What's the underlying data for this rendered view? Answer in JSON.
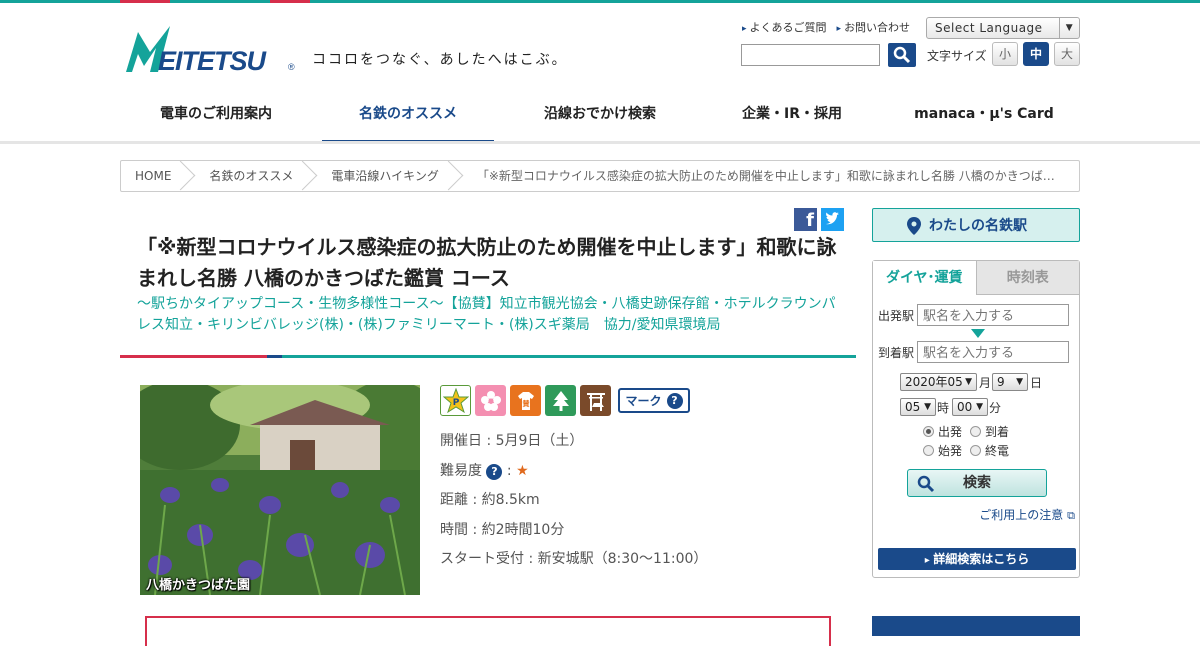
{
  "header": {
    "logo_text": "MEITETSU",
    "tagline": "ココロをつなぐ、あしたへはこぶ。",
    "util_links": [
      "よくあるご質問",
      "お問い合わせ"
    ],
    "language_select": "Select Language",
    "fontsize_label": "文字サイズ",
    "fontsize_options": [
      "小",
      "中",
      "大"
    ]
  },
  "nav": {
    "items": [
      "電車のご利用案内",
      "名鉄のオススメ",
      "沿線おでかけ検索",
      "企業・IR・採用",
      "manaca・μ's Card"
    ]
  },
  "breadcrumb": [
    "HOME",
    "名鉄のオススメ",
    "電車沿線ハイキング",
    "「※新型コロナウイルス感染症の拡大防止のため開催を中止します」和歌に詠まれし名勝 八橋のかきつば…"
  ],
  "article": {
    "title": "「※新型コロナウイルス感染症の拡大防止のため開催を中止します」和歌に詠まれし名勝 八橋のかきつばた鑑賞 コース",
    "subtitle": "～駅ちかタイアップコース・生物多様性コース～【協賛】知立市観光協会・八橋史跡保存館・ホテルクラウンパレス知立・キリンビバレッジ(株)・(株)ファミリーマート・(株)スギ薬局　協力/愛知県環境局",
    "photo_caption": "八橋かきつばた園",
    "mark_label": "マーク",
    "date": "開催日 : 5月9日（土）",
    "difficulty_label": "難易度",
    "difficulty_star": "★",
    "distance": "距離 : 約8.5km",
    "time": "時間 : 約2時間10分",
    "start": "スタート受付 : 新安城駅（8:30～11:00）"
  },
  "sidebar": {
    "my_station": "わたしの名鉄駅",
    "tabs": [
      "ダイヤ･運賃",
      "時刻表"
    ],
    "from_label": "出発駅",
    "to_label": "到着駅",
    "placeholder": "駅名を入力する",
    "year_month": "2020年05",
    "month_unit": "月",
    "day": "9",
    "day_unit": "日",
    "hour": "05",
    "hour_unit": "時",
    "minute": "00",
    "minute_unit": "分",
    "radios": [
      "出発",
      "到着",
      "始発",
      "終電"
    ],
    "search": "検索",
    "note": "ご利用上の注意",
    "detail": "詳細検索はこちら"
  },
  "colors": {
    "teal": "#14a39a",
    "navy": "#1a4a8a",
    "red": "#d62f4b"
  }
}
